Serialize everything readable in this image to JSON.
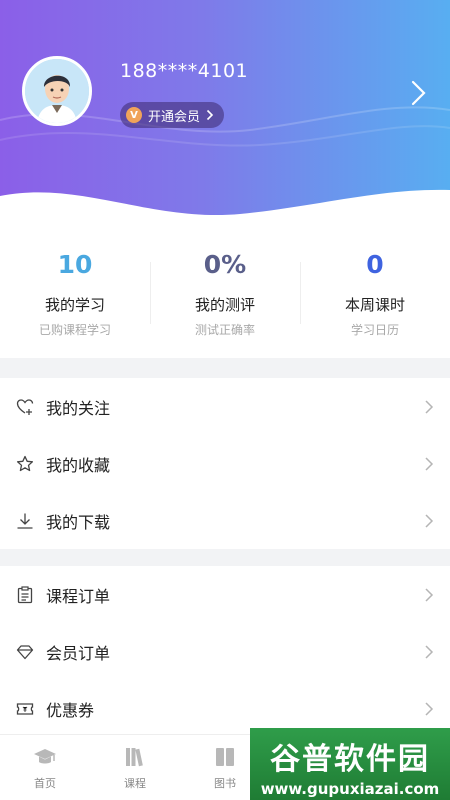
{
  "user": {
    "phone": "188****4101",
    "vip_label": "开通会员",
    "vip_badge": "V"
  },
  "stats": [
    {
      "value": "10",
      "title": "我的学习",
      "sub": "已购课程学习",
      "color": "#4aa8e0"
    },
    {
      "value": "0%",
      "title": "我的测评",
      "sub": "测试正确率",
      "color": "#5a5f8a"
    },
    {
      "value": "0",
      "title": "本周课时",
      "sub": "学习日历",
      "color": "#3f63e0"
    }
  ],
  "menu_group_1": [
    {
      "label": "我的关注",
      "icon": "heart-plus-icon"
    },
    {
      "label": "我的收藏",
      "icon": "star-icon"
    },
    {
      "label": "我的下载",
      "icon": "download-icon"
    }
  ],
  "menu_group_2": [
    {
      "label": "课程订单",
      "icon": "clipboard-icon"
    },
    {
      "label": "会员订单",
      "icon": "diamond-icon"
    },
    {
      "label": "优惠券",
      "icon": "coupon-icon"
    }
  ],
  "tabbar": [
    {
      "label": "首页",
      "icon": "graduation-cap-icon"
    },
    {
      "label": "课程",
      "icon": "books-icon"
    },
    {
      "label": "图书",
      "icon": "book-stack-icon"
    }
  ],
  "watermark": {
    "title": "谷普软件园",
    "url": "www.gupuxiazai.com"
  },
  "colors": {
    "header_start": "#8b5fe8",
    "header_end": "#58aef1",
    "watermark": "#2f9d4a"
  }
}
